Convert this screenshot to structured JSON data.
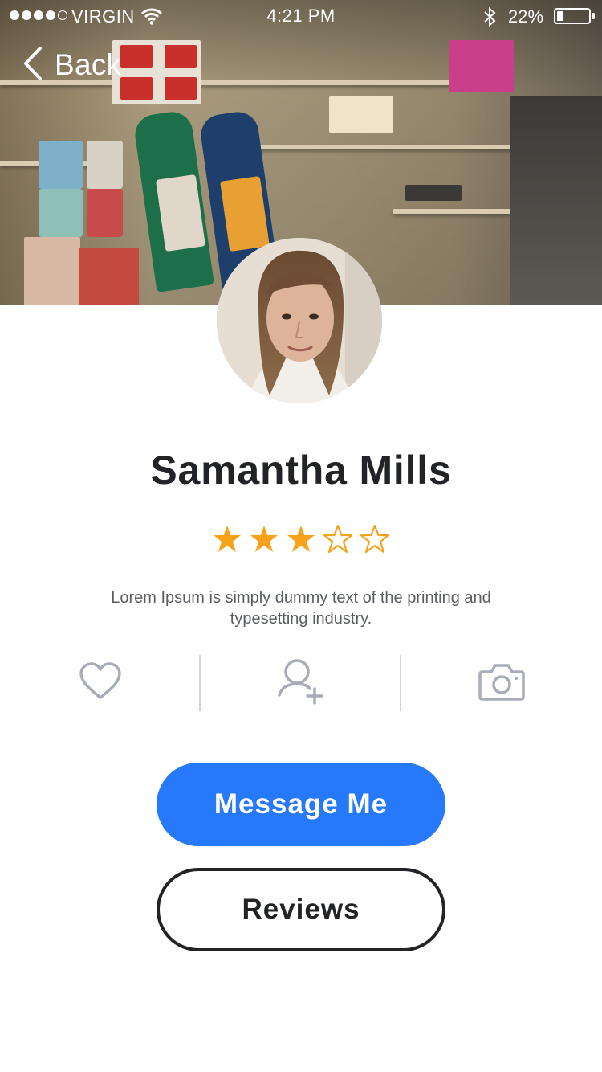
{
  "status_bar": {
    "signal_filled": 4,
    "signal_total": 5,
    "carrier": "VIRGIN",
    "time": "4:21 PM",
    "battery_percent": "22%",
    "battery_level": 0.22
  },
  "nav": {
    "back_label": "Back",
    "back_icon": "chevron-left-icon"
  },
  "profile": {
    "name": "Samantha Mills",
    "rating": 3,
    "rating_max": 5,
    "bio": "Lorem Ipsum is simply dummy text of the printing and typesetting industry."
  },
  "actions": [
    {
      "icon": "heart-icon"
    },
    {
      "icon": "add-user-icon"
    },
    {
      "icon": "camera-icon"
    }
  ],
  "buttons": {
    "message_label": "Message Me",
    "reviews_label": "Reviews"
  },
  "colors": {
    "primary": "#2579fa",
    "star": "#f7a21b",
    "text_dark": "#222326",
    "text_muted": "#5a5d63",
    "icon_muted": "#a8abb8"
  }
}
